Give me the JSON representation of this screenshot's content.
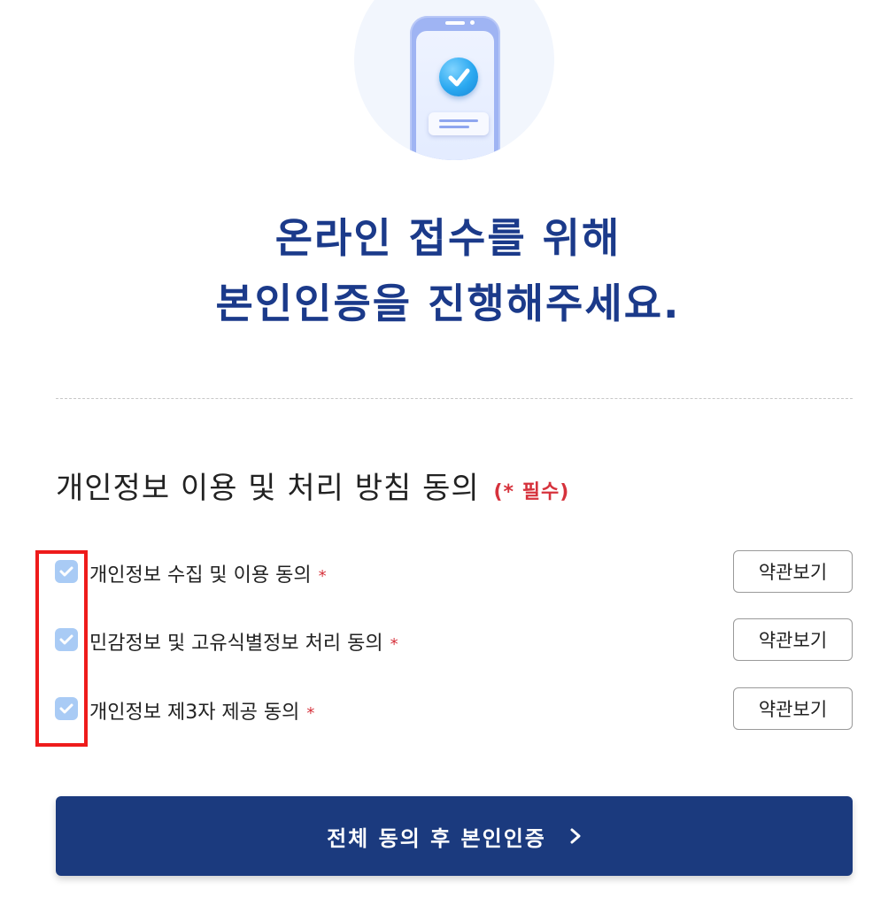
{
  "hero": {
    "icon": "phone-verified-icon"
  },
  "title": {
    "line1": "온라인 접수를 위해",
    "line2": "본인인증을 진행해주세요."
  },
  "consent_section": {
    "heading": "개인정보 이용 및 처리 방침 동의",
    "required_note": "(* 필수)",
    "items": [
      {
        "label": "개인정보 수집 및 이용 동의",
        "required_mark": "*",
        "checked": true,
        "terms_button": "약관보기"
      },
      {
        "label": "민감정보 및 고유식별정보 처리 동의",
        "required_mark": "*",
        "checked": true,
        "terms_button": "약관보기"
      },
      {
        "label": "개인정보 제3자 제공 동의",
        "required_mark": "*",
        "checked": true,
        "terms_button": "약관보기"
      }
    ]
  },
  "submit": {
    "label": "전체 동의 후 본인인증",
    "icon": "chevron-right-icon"
  },
  "colors": {
    "title": "#1b3a8a",
    "required": "#d6323c",
    "checkbox": "#a9cbf5",
    "submit_bg": "#1b3a7e",
    "highlight": "#ee1b1b"
  }
}
